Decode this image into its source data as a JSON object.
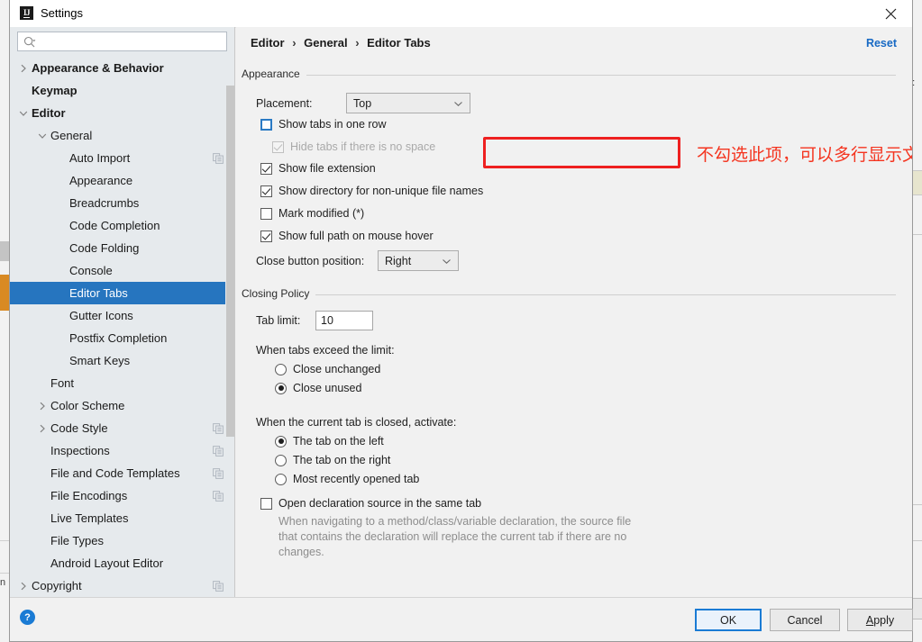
{
  "background": {
    "left_text": "n",
    "right_text": "a:"
  },
  "window": {
    "title": "Settings",
    "app_icon": "intellij-idea-icon",
    "close_icon": "close-icon"
  },
  "sidebar": {
    "search": {
      "placeholder": "",
      "value": "",
      "icon": "search-icon"
    },
    "items": [
      {
        "label": "Appearance & Behavior",
        "depth": 0,
        "twisty": "collapsed",
        "bold": true,
        "selected": false,
        "copy": false
      },
      {
        "label": "Keymap",
        "depth": 0,
        "twisty": "none",
        "bold": true,
        "selected": false,
        "copy": false
      },
      {
        "label": "Editor",
        "depth": 0,
        "twisty": "expanded",
        "bold": true,
        "selected": false,
        "copy": false
      },
      {
        "label": "General",
        "depth": 1,
        "twisty": "expanded",
        "bold": false,
        "selected": false,
        "copy": false
      },
      {
        "label": "Auto Import",
        "depth": 2,
        "twisty": "none",
        "bold": false,
        "selected": false,
        "copy": true
      },
      {
        "label": "Appearance",
        "depth": 2,
        "twisty": "none",
        "bold": false,
        "selected": false,
        "copy": false
      },
      {
        "label": "Breadcrumbs",
        "depth": 2,
        "twisty": "none",
        "bold": false,
        "selected": false,
        "copy": false
      },
      {
        "label": "Code Completion",
        "depth": 2,
        "twisty": "none",
        "bold": false,
        "selected": false,
        "copy": false
      },
      {
        "label": "Code Folding",
        "depth": 2,
        "twisty": "none",
        "bold": false,
        "selected": false,
        "copy": false
      },
      {
        "label": "Console",
        "depth": 2,
        "twisty": "none",
        "bold": false,
        "selected": false,
        "copy": false
      },
      {
        "label": "Editor Tabs",
        "depth": 2,
        "twisty": "none",
        "bold": false,
        "selected": true,
        "copy": false
      },
      {
        "label": "Gutter Icons",
        "depth": 2,
        "twisty": "none",
        "bold": false,
        "selected": false,
        "copy": false
      },
      {
        "label": "Postfix Completion",
        "depth": 2,
        "twisty": "none",
        "bold": false,
        "selected": false,
        "copy": false
      },
      {
        "label": "Smart Keys",
        "depth": 2,
        "twisty": "none",
        "bold": false,
        "selected": false,
        "copy": false
      },
      {
        "label": "Font",
        "depth": 1,
        "twisty": "none",
        "bold": false,
        "selected": false,
        "copy": false
      },
      {
        "label": "Color Scheme",
        "depth": 1,
        "twisty": "collapsed",
        "bold": false,
        "selected": false,
        "copy": false
      },
      {
        "label": "Code Style",
        "depth": 1,
        "twisty": "collapsed",
        "bold": false,
        "selected": false,
        "copy": true
      },
      {
        "label": "Inspections",
        "depth": 1,
        "twisty": "none",
        "bold": false,
        "selected": false,
        "copy": true
      },
      {
        "label": "File and Code Templates",
        "depth": 1,
        "twisty": "none",
        "bold": false,
        "selected": false,
        "copy": true
      },
      {
        "label": "File Encodings",
        "depth": 1,
        "twisty": "none",
        "bold": false,
        "selected": false,
        "copy": true
      },
      {
        "label": "Live Templates",
        "depth": 1,
        "twisty": "none",
        "bold": false,
        "selected": false,
        "copy": false
      },
      {
        "label": "File Types",
        "depth": 1,
        "twisty": "none",
        "bold": false,
        "selected": false,
        "copy": false
      },
      {
        "label": "Android Layout Editor",
        "depth": 1,
        "twisty": "none",
        "bold": false,
        "selected": false,
        "copy": false
      },
      {
        "label": "Copyright",
        "depth": 0,
        "twisty": "collapsed",
        "bold": false,
        "selected": false,
        "copy": true
      }
    ]
  },
  "main": {
    "breadcrumb": {
      "part1": "Editor",
      "part2": "General",
      "part3": "Editor Tabs",
      "separator": "›"
    },
    "reset_label": "Reset",
    "appearance": {
      "group_title": "Appearance",
      "placement_label": "Placement:",
      "placement_value": "Top",
      "show_tabs_one_row": {
        "label": "Show tabs in one row",
        "checked": false,
        "focused": true
      },
      "hide_tabs_no_space": {
        "label": "Hide tabs if there is no space",
        "checked": true,
        "disabled": true
      },
      "show_file_extension": {
        "label": "Show file extension",
        "checked": true
      },
      "show_directory": {
        "label": "Show directory for non-unique file names",
        "checked": true
      },
      "mark_modified": {
        "label": "Mark modified (*)",
        "checked": false
      },
      "show_full_path": {
        "label": "Show full path on mouse hover",
        "checked": true
      },
      "close_button_label": "Close button position:",
      "close_button_value": "Right"
    },
    "closing_policy": {
      "group_title": "Closing Policy",
      "tab_limit_label": "Tab limit:",
      "tab_limit_value": "10",
      "exceed_heading": "When tabs exceed the limit:",
      "exceed_options": [
        {
          "label": "Close unchanged",
          "selected": false
        },
        {
          "label": "Close unused",
          "selected": true
        }
      ],
      "activate_heading": "When the current tab is closed, activate:",
      "activate_options": [
        {
          "label": "The tab on the left",
          "selected": true
        },
        {
          "label": "The tab on the right",
          "selected": false
        },
        {
          "label": "Most recently opened tab",
          "selected": false
        }
      ],
      "open_declaration": {
        "label": "Open declaration source in the same tab",
        "checked": false
      },
      "open_declaration_help": "When navigating to a method/class/variable declaration, the source file that contains the declaration will replace the current tab if there are no changes."
    }
  },
  "annotation": {
    "note_text": "不勾选此项，可以多行显示文件列表",
    "highlight_color": "#ee2020",
    "note_color": "#f4341f"
  },
  "footer": {
    "help_icon": "help-icon",
    "help_glyph": "?",
    "ok_label": "OK",
    "cancel_label": "Cancel",
    "apply_label_head": "A",
    "apply_label_tail": "pply"
  }
}
